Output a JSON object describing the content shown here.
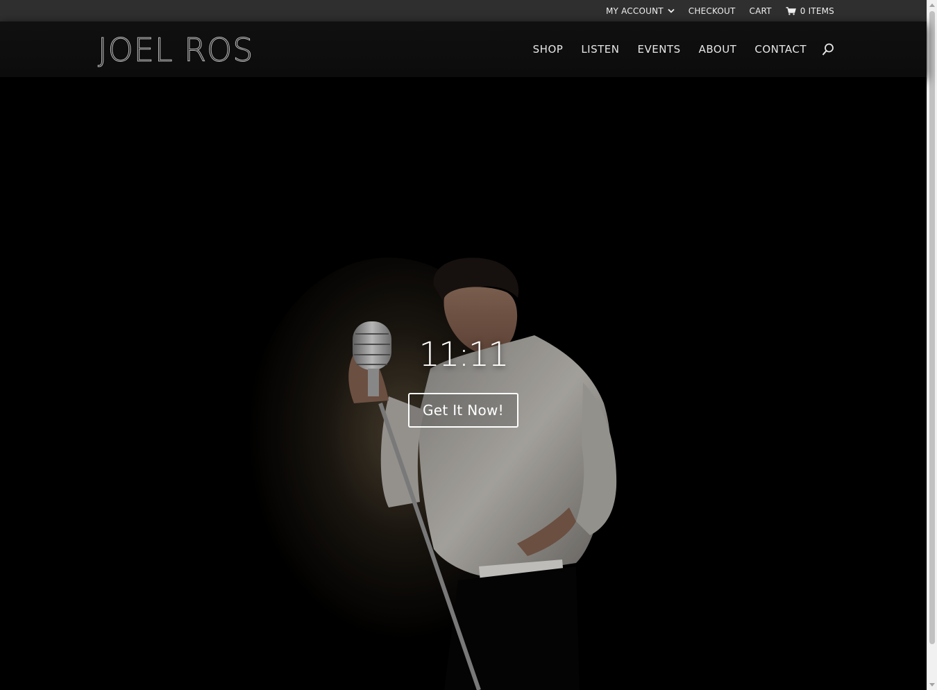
{
  "topbar": {
    "my_account": "MY ACCOUNT",
    "checkout": "CHECKOUT",
    "cart": "CART",
    "cart_items": "0 ITEMS",
    "icons": [
      "chevron-down-icon",
      "cart-icon"
    ]
  },
  "header": {
    "logo": "JOEL ROS",
    "nav": [
      "SHOP",
      "LISTEN",
      "EVENTS",
      "ABOUT",
      "CONTACT"
    ],
    "search_icon": "search-icon"
  },
  "hero": {
    "title": "11:11",
    "cta_label": "Get It Now!"
  },
  "colors": {
    "topbar_bg": "#2f2f2f",
    "header_bg": "#101010",
    "hero_bg": "#000000",
    "text": "#ffffff"
  }
}
